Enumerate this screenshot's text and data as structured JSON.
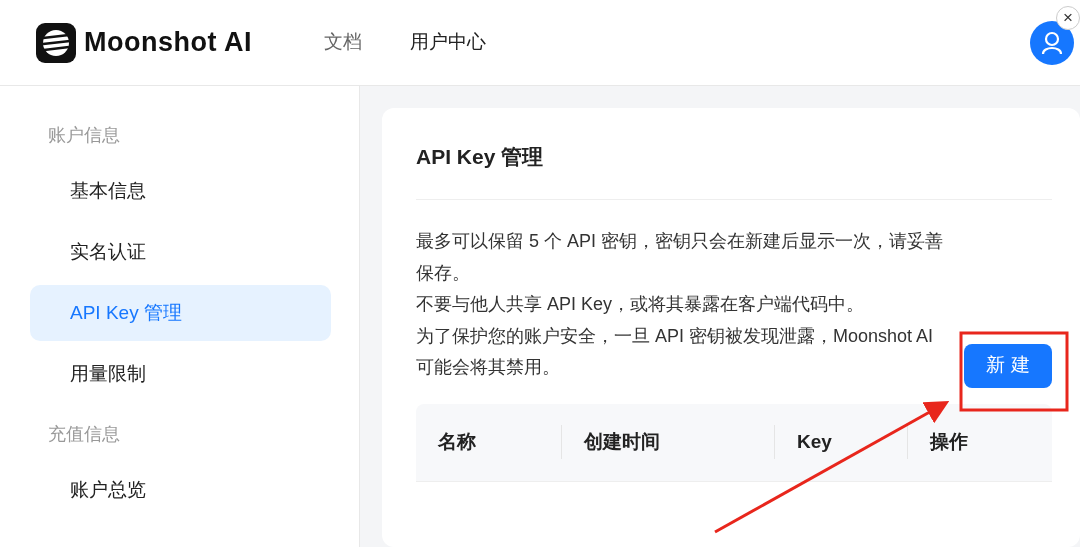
{
  "header": {
    "brand": "Moonshot AI",
    "nav": [
      {
        "label": "文档",
        "selected": false
      },
      {
        "label": "用户中心",
        "selected": true
      }
    ],
    "close_label": "×"
  },
  "sidebar": {
    "groups": [
      {
        "title": "账户信息",
        "items": [
          {
            "label": "基本信息",
            "selected": false
          },
          {
            "label": "实名认证",
            "selected": false
          },
          {
            "label": "API Key 管理",
            "selected": true
          },
          {
            "label": "用量限制",
            "selected": false
          }
        ]
      },
      {
        "title": "充值信息",
        "items": [
          {
            "label": "账户总览",
            "selected": false
          }
        ]
      }
    ]
  },
  "content": {
    "title": "API Key 管理",
    "notes": [
      "最多可以保留 5 个 API 密钥，密钥只会在新建后显示一次，请妥善保存。",
      "不要与他人共享 API Key，或将其暴露在客户端代码中。",
      "为了保护您的账户安全，一旦 API 密钥被发现泄露，Moonshot AI 可能会将其禁用。"
    ],
    "create_button": "新 建",
    "table": {
      "columns": [
        "名称",
        "创建时间",
        "Key",
        "操作"
      ]
    }
  }
}
